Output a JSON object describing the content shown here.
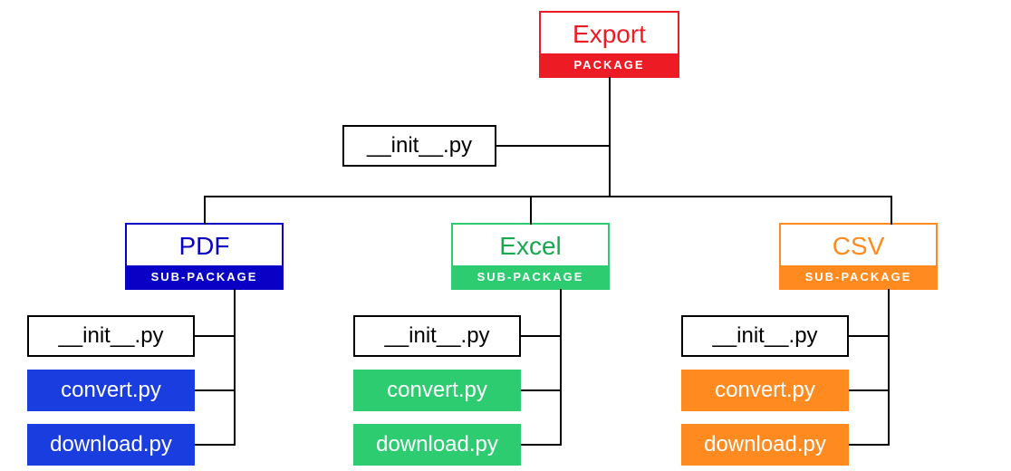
{
  "root": {
    "title": "Export",
    "tag": "PACKAGE",
    "init": "__init__.py"
  },
  "subs": [
    {
      "title": "PDF",
      "tag": "SUB-PACKAGE",
      "files": [
        "__init__.py",
        "convert.py",
        "download.py"
      ]
    },
    {
      "title": "Excel",
      "tag": "SUB-PACKAGE",
      "files": [
        "__init__.py",
        "convert.py",
        "download.py"
      ]
    },
    {
      "title": "CSV",
      "tag": "SUB-PACKAGE",
      "files": [
        "__init__.py",
        "convert.py",
        "download.py"
      ]
    }
  ]
}
